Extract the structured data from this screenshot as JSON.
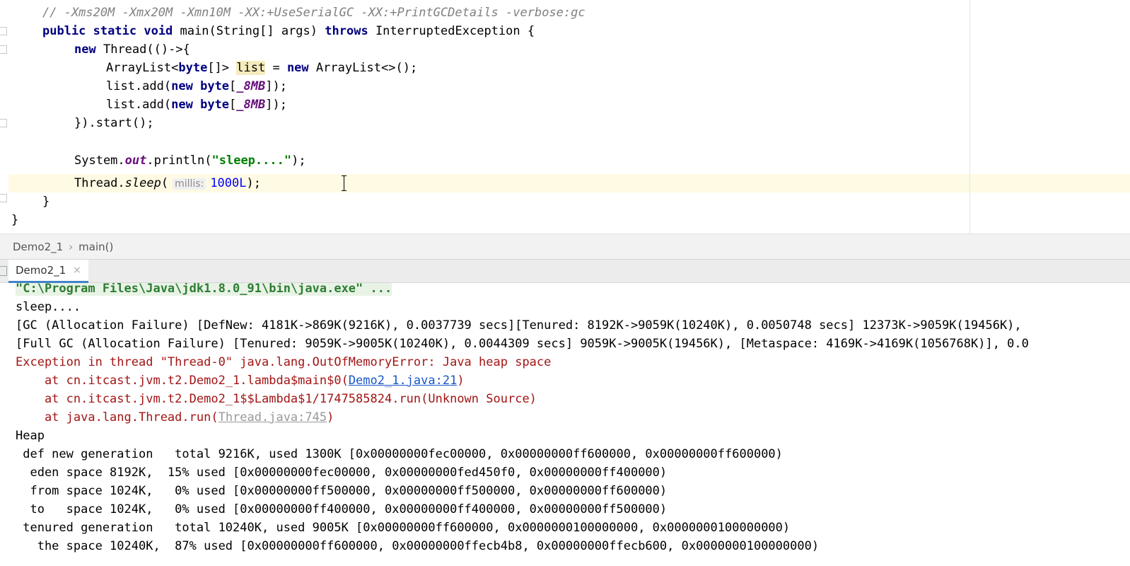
{
  "editor": {
    "lines": [
      {
        "comment": "// -Xms20M -Xmx20M -Xmn10M -XX:+UseSerialGC -XX:+PrintGCDetails -verbose:gc"
      },
      {
        "kw1": "public",
        "kw2": "static",
        "kw3": "void",
        "name": "main(String[] args)",
        "kw4": "throws",
        "rest": "InterruptedException {"
      },
      {
        "kw": "new",
        "rest": "Thread(()->{"
      },
      {
        "pre": "ArrayList<",
        "kw": "byte",
        "mid": "[]> ",
        "var": "list",
        "eq": " = ",
        "kw2": "new",
        "rest": "ArrayList<>();"
      },
      {
        "pre": "list.add(",
        "kw": "new",
        "kw2": "byte",
        "br": "[",
        "const": "_8MB",
        "rest": "]);"
      },
      {
        "pre": "list.add(",
        "kw": "new",
        "kw2": "byte",
        "br": "[",
        "const": "_8MB",
        "rest": "]);"
      },
      {
        "text": "}).start();"
      },
      {
        "text": ""
      },
      {
        "pre": "System.",
        "field": "out",
        "mid": ".println(",
        "str": "\"sleep....\"",
        "rest": ");"
      },
      {
        "pre": "Thread.",
        "method": "sleep",
        "paren": "(",
        "hint": "millis:",
        "num": "1000L",
        "rest": ");"
      },
      {
        "text": "}"
      },
      {
        "text": "}"
      }
    ]
  },
  "breadcrumb": {
    "items": [
      "Demo2_1",
      "main()"
    ],
    "separator": "›"
  },
  "run_panel": {
    "tab_label": "Demo2_1",
    "close": "×"
  },
  "console": {
    "lines": [
      "\"C:\\Program Files\\Java\\jdk1.8.0_91\\bin\\java.exe\" ...",
      "sleep....",
      "[GC (Allocation Failure) [DefNew: 4181K->869K(9216K), 0.0037739 secs][Tenured: 8192K->9059K(10240K), 0.0050748 secs] 12373K->9059K(19456K),",
      "[Full GC (Allocation Failure) [Tenured: 9059K->9005K(10240K), 0.0044309 secs] 9059K->9005K(19456K), [Metaspace: 4169K->4169K(1056768K)], 0.0",
      "Exception in thread \"Thread-0\" java.lang.OutOfMemoryError: Java heap space",
      {
        "pre": "    at cn.itcast.jvm.t2.Demo2_1.lambda$main$0(",
        "link": "Demo2_1.java:21",
        "post": ")"
      },
      "    at cn.itcast.jvm.t2.Demo2_1$$Lambda$1/1747585824.run(Unknown Source)",
      {
        "pre": "    at java.lang.Thread.run(",
        "link": "Thread.java:745",
        "post": ")"
      },
      "Heap",
      " def new generation   total 9216K, used 1300K [0x00000000fec00000, 0x00000000ff600000, 0x00000000ff600000)",
      "  eden space 8192K,  15% used [0x00000000fec00000, 0x00000000fed450f0, 0x00000000ff400000)",
      "  from space 1024K,   0% used [0x00000000ff500000, 0x00000000ff500000, 0x00000000ff600000)",
      "  to   space 1024K,   0% used [0x00000000ff400000, 0x00000000ff400000, 0x00000000ff500000)",
      " tenured generation   total 10240K, used 9005K [0x00000000ff600000, 0x0000000100000000, 0x0000000100000000)",
      "   the space 10240K,  87% used [0x00000000ff600000, 0x00000000ffecb4b8, 0x00000000ffecb600, 0x0000000100000000)"
    ]
  }
}
